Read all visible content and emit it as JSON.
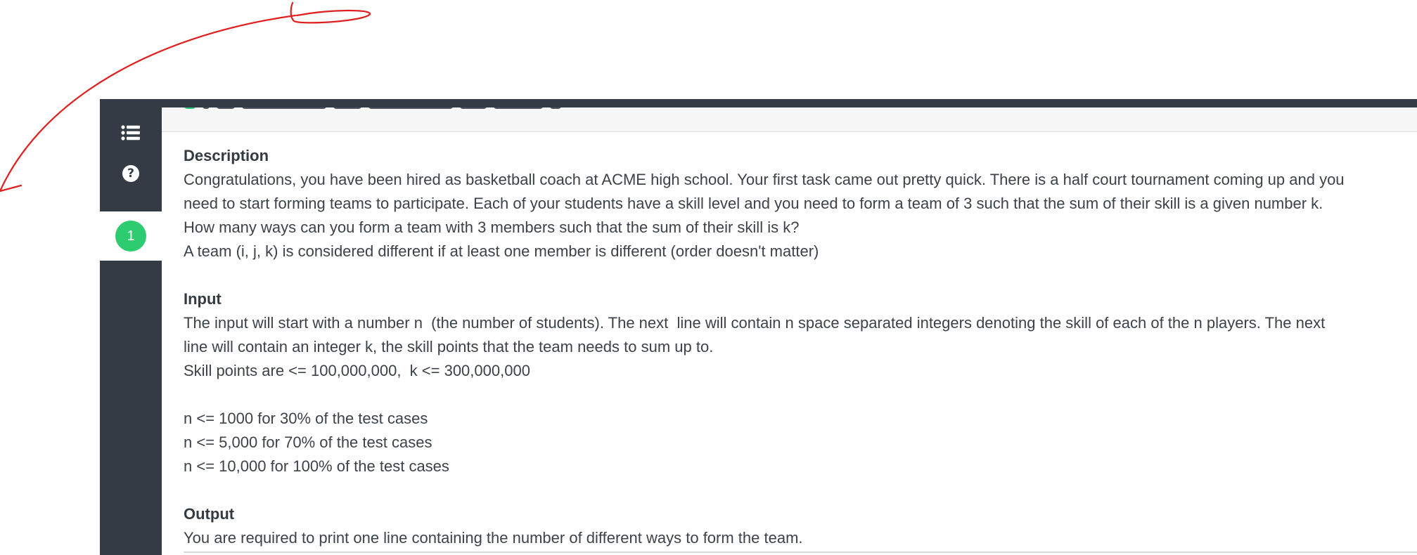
{
  "sidebar": {
    "list_icon": "list-icon",
    "help_icon": "question-circle-icon",
    "help_glyph": "?",
    "problem_number": "1",
    "problem_badge_color": "#2ecc71",
    "background_color": "#343b44"
  },
  "annotation": {
    "stroke_color": "#e02020",
    "shape": "hand-drawn arrow curve"
  },
  "problem": {
    "description": {
      "title": "Description",
      "lines": [
        "Congratulations, you have been hired as basketball coach at ACME high school. Your first task came out pretty quick. There is a half court tournament coming up and you",
        "need to start forming teams to participate. Each of your students have a skill level and you need to form a team of 3 such that the sum of their skill is a given number k.",
        "How many ways can you form a team with 3 members such that the sum of their skill is k?",
        "A team (i, j, k) is considered different if at least one member is different (order doesn't matter)"
      ]
    },
    "input": {
      "title": "Input",
      "lines": [
        "The input will start with a number n  (the number of students). The next  line will contain n space separated integers denoting the skill of each of the n players. The next",
        "line will contain an integer k, the skill points that the team needs to sum up to.",
        "Skill points are <= 100,000,000,  k <= 300,000,000"
      ],
      "constraints": [
        "n <= 1000 for 30% of the test cases",
        "n <= 5,000 for 70% of the test cases",
        "n <= 10,000 for 100% of the test cases"
      ]
    },
    "output": {
      "title": "Output",
      "lines": [
        "You are required to print one line containing the number of different ways to form the team."
      ]
    }
  }
}
